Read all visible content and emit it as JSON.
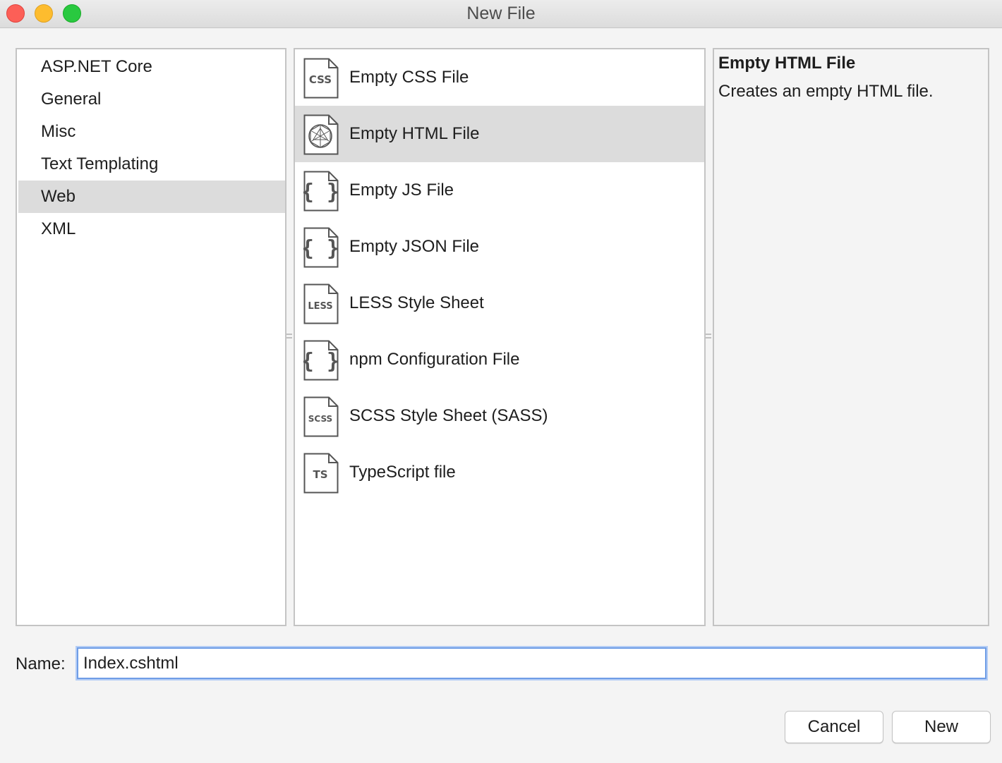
{
  "window": {
    "title": "New File"
  },
  "categories": {
    "items": [
      "ASP.NET Core",
      "General",
      "Misc",
      "Text Templating",
      "Web",
      "XML"
    ],
    "selected": "Web"
  },
  "templates": {
    "items": [
      {
        "label": "Empty CSS File",
        "icon": "css-file-icon",
        "icon_text": "CSS"
      },
      {
        "label": "Empty HTML File",
        "icon": "html-file-icon",
        "icon_text": ""
      },
      {
        "label": "Empty JS File",
        "icon": "js-braces-file-icon",
        "icon_text": "{ }"
      },
      {
        "label": "Empty JSON File",
        "icon": "json-braces-file-icon",
        "icon_text": "{ }"
      },
      {
        "label": "LESS Style Sheet",
        "icon": "less-file-icon",
        "icon_text": "LESS"
      },
      {
        "label": "npm Configuration File",
        "icon": "npm-braces-file-icon",
        "icon_text": "{ }"
      },
      {
        "label": "SCSS Style Sheet (SASS)",
        "icon": "scss-file-icon",
        "icon_text": "SCSS"
      },
      {
        "label": "TypeScript file",
        "icon": "ts-file-icon",
        "icon_text": "TS"
      }
    ],
    "selected": "Empty HTML File"
  },
  "description": {
    "title": "Empty HTML File",
    "text": "Creates an empty HTML file."
  },
  "name_field": {
    "label": "Name:",
    "value": "Index.cshtml"
  },
  "buttons": {
    "cancel": "Cancel",
    "new": "New"
  },
  "colors": {
    "selection": "#dcdcdc",
    "focus_ring": "#6f9de6"
  }
}
